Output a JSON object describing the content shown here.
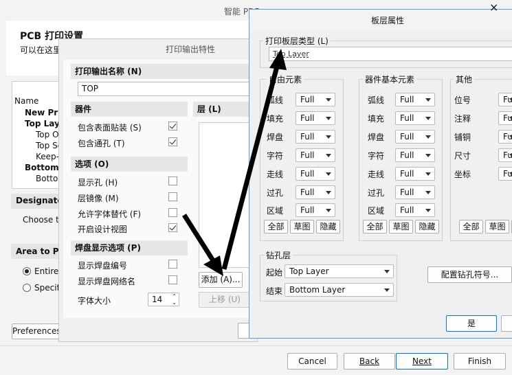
{
  "wizard": {
    "title": "智能 PDF",
    "close": "×",
    "heading": "PCB 打印设置",
    "subtitle": "可以在这里",
    "table_col": "Name",
    "tree": [
      "New Prin",
      "Top Laye",
      "Top Ov",
      "Top Sc",
      "Keep-C",
      "Bottom L",
      "Botto"
    ],
    "designator_label": "Designator",
    "choose_text": "Choose th",
    "area_label": "Area to Prin",
    "radio_entire": "Entire",
    "radio_specific": "Specifi",
    "preferences": "Preferences",
    "cancel": "Cancel",
    "back": "Back",
    "next": "Next",
    "finish": "Finish"
  },
  "print_props": {
    "title": "打印输出特性",
    "name_label": "打印输出名称 (N)",
    "name_value": "TOP",
    "layers_label": "层 (L)",
    "components_header": "器件",
    "include_smd": "包含表面贴装 (S)",
    "include_th": "包含通孔 (T)",
    "options_header": "选项 (O)",
    "show_holes": "显示孔 (H)",
    "mirror": "层镜像 (M)",
    "font_sub": "允许字体替代 (F)",
    "design_view": "开启设计视图",
    "pad_header": "焊盘显示选项 (P)",
    "pad_numbers": "显示焊盘编号",
    "pad_nets": "显示焊盘网络名",
    "font_size_label": "字体大小",
    "font_size_value": "14",
    "add_button": "添加 (A)...",
    "move_up": "上移 (U)"
  },
  "board_props": {
    "title": "板层属性",
    "close": "×",
    "layer_type_label": "打印板层类型 (L)",
    "layer_type_value": "Top Layer",
    "free_title": "自由元素",
    "comp_title": "器件基本元素",
    "other_title": "其他",
    "free_rows": [
      "弧线",
      "填充",
      "焊盘",
      "字符",
      "走线",
      "过孔",
      "区域"
    ],
    "comp_rows": [
      "弧线",
      "填充",
      "焊盘",
      "字符",
      "走线",
      "过孔",
      "区域"
    ],
    "other_rows": [
      "位号",
      "注释",
      "铺铜",
      "尺寸",
      "坐标"
    ],
    "full": "Full",
    "other_full": "Fu",
    "btn_all": "全部",
    "btn_draft": "草图",
    "btn_hide": "隐藏",
    "drill_title": "钻孔层",
    "drill_start_label": "起始",
    "drill_start_value": "Top Layer",
    "drill_end_label": "结束",
    "drill_end_value": "Bottom Layer",
    "drill_symbols": "配置钻孔符号...",
    "ok": "是"
  }
}
